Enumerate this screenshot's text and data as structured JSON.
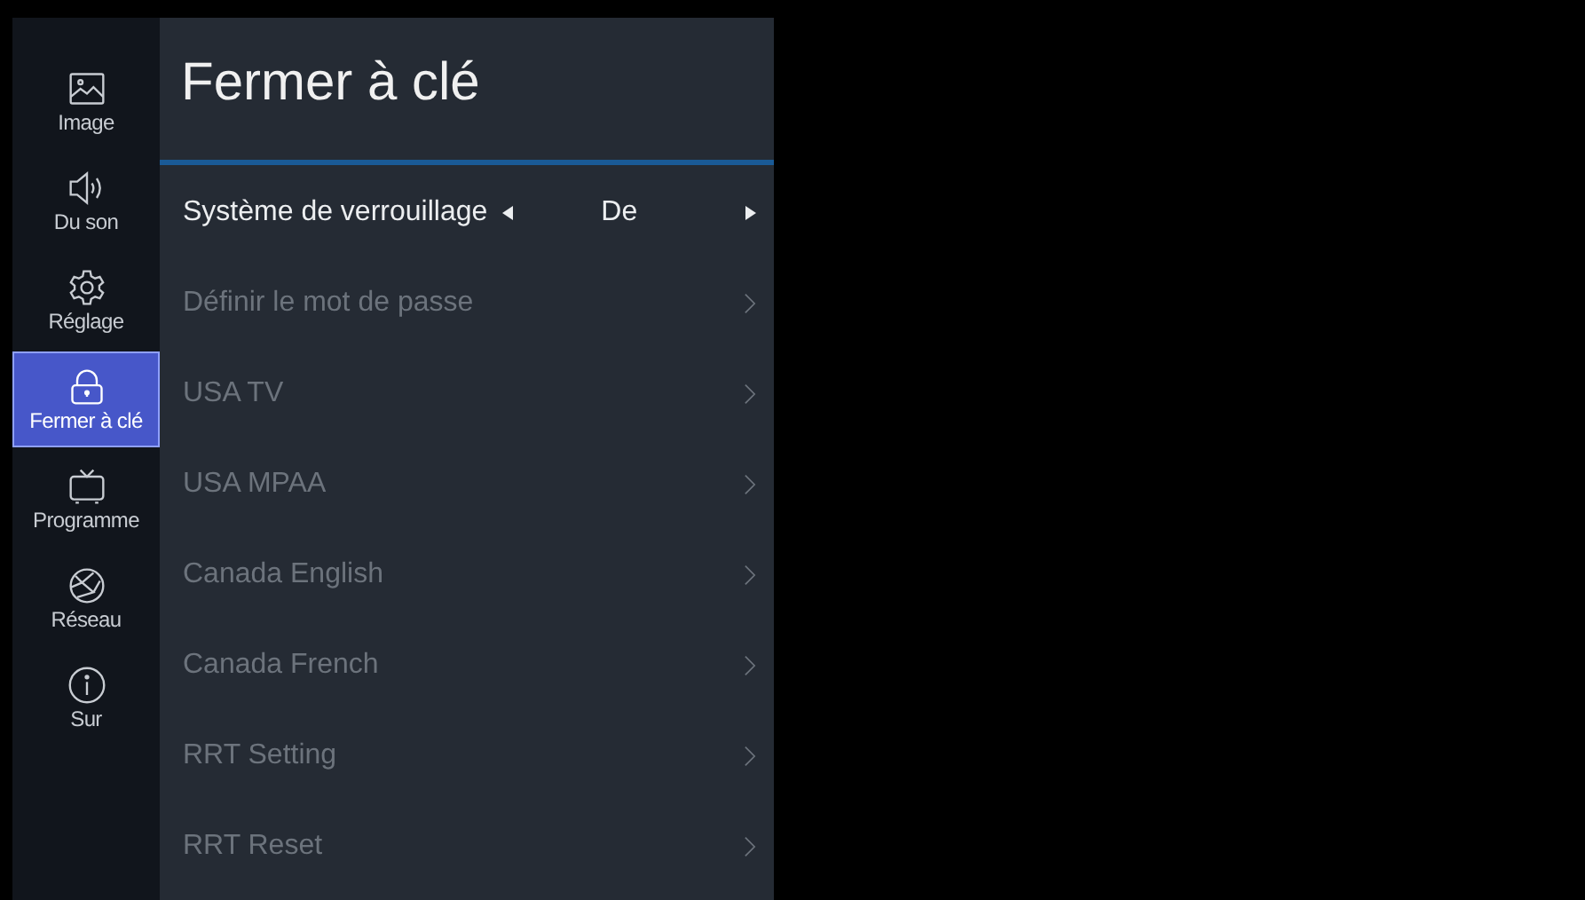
{
  "sidebar": {
    "items": [
      {
        "label": "Image",
        "kind": "image",
        "selected": false
      },
      {
        "label": "Du son",
        "kind": "sound",
        "selected": false
      },
      {
        "label": "Réglage",
        "kind": "gear",
        "selected": false
      },
      {
        "label": "Fermer à clé",
        "kind": "lock",
        "selected": true
      },
      {
        "label": "Programme",
        "kind": "tv",
        "selected": false
      },
      {
        "label": "Réseau",
        "kind": "globe",
        "selected": false
      },
      {
        "label": "Sur",
        "kind": "info",
        "selected": false
      }
    ]
  },
  "panel": {
    "title": "Fermer à clé",
    "items": [
      {
        "kind": "option",
        "label": "Système de verrouillage",
        "value": "De",
        "disabled": false
      },
      {
        "kind": "submenu",
        "label": "Définir le mot de passe",
        "disabled": true
      },
      {
        "kind": "submenu",
        "label": "USA TV",
        "disabled": true
      },
      {
        "kind": "submenu",
        "label": "USA MPAA",
        "disabled": true
      },
      {
        "kind": "submenu",
        "label": "Canada English",
        "disabled": true
      },
      {
        "kind": "submenu",
        "label": "Canada French",
        "disabled": true
      },
      {
        "kind": "submenu",
        "label": "RRT Setting",
        "disabled": true
      },
      {
        "kind": "submenu",
        "label": "RRT Reset",
        "disabled": true
      }
    ]
  }
}
